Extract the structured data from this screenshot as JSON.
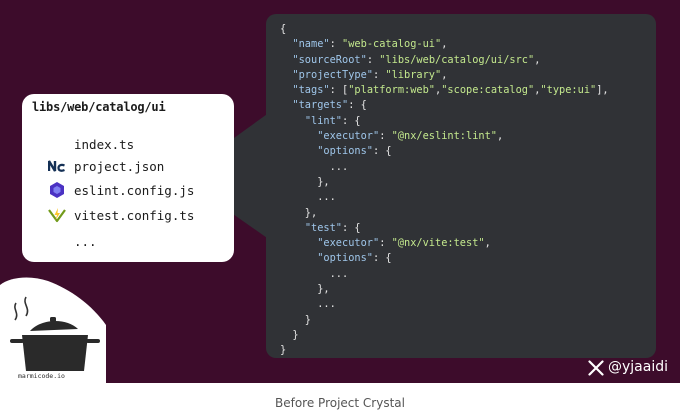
{
  "card": {
    "title": "libs/web/catalog/ui",
    "files": [
      {
        "name": "index.ts",
        "icon": "none"
      },
      {
        "name": "project.json",
        "icon": "nx-icon"
      },
      {
        "name": "eslint.config.js",
        "icon": "eslint-icon"
      },
      {
        "name": "vitest.config.ts",
        "icon": "vitest-icon"
      },
      {
        "name": "...",
        "icon": "none"
      }
    ]
  },
  "code_lines": [
    [
      [
        "p",
        "{"
      ]
    ],
    [
      [
        "p",
        "  "
      ],
      [
        "k",
        "\"name\""
      ],
      [
        "p",
        ": "
      ],
      [
        "s",
        "\"web-catalog-ui\""
      ],
      [
        "p",
        ","
      ]
    ],
    [
      [
        "p",
        "  "
      ],
      [
        "k",
        "\"sourceRoot\""
      ],
      [
        "p",
        ": "
      ],
      [
        "s",
        "\"libs/web/catalog/ui/src\""
      ],
      [
        "p",
        ","
      ]
    ],
    [
      [
        "p",
        "  "
      ],
      [
        "k",
        "\"projectType\""
      ],
      [
        "p",
        ": "
      ],
      [
        "s",
        "\"library\""
      ],
      [
        "p",
        ","
      ]
    ],
    [
      [
        "p",
        "  "
      ],
      [
        "k",
        "\"tags\""
      ],
      [
        "p",
        ": ["
      ],
      [
        "s",
        "\"platform:web\""
      ],
      [
        "p",
        ","
      ],
      [
        "s",
        "\"scope:catalog\""
      ],
      [
        "p",
        ","
      ],
      [
        "s",
        "\"type:ui\""
      ],
      [
        "p",
        "],"
      ]
    ],
    [
      [
        "p",
        "  "
      ],
      [
        "k",
        "\"targets\""
      ],
      [
        "p",
        ": {"
      ]
    ],
    [
      [
        "p",
        "    "
      ],
      [
        "k",
        "\"lint\""
      ],
      [
        "p",
        ": {"
      ]
    ],
    [
      [
        "p",
        "      "
      ],
      [
        "k",
        "\"executor\""
      ],
      [
        "p",
        ": "
      ],
      [
        "s",
        "\"@nx/eslint:lint\""
      ],
      [
        "p",
        ","
      ]
    ],
    [
      [
        "p",
        "      "
      ],
      [
        "k",
        "\"options\""
      ],
      [
        "p",
        ": {"
      ]
    ],
    [
      [
        "p",
        "        ..."
      ]
    ],
    [
      [
        "p",
        "      },"
      ]
    ],
    [
      [
        "p",
        "      ..."
      ]
    ],
    [
      [
        "p",
        "    },"
      ]
    ],
    [
      [
        "p",
        "    "
      ],
      [
        "k",
        "\"test\""
      ],
      [
        "p",
        ": {"
      ]
    ],
    [
      [
        "p",
        "      "
      ],
      [
        "k",
        "\"executor\""
      ],
      [
        "p",
        ": "
      ],
      [
        "s",
        "\"@nx/vite:test\""
      ],
      [
        "p",
        ","
      ]
    ],
    [
      [
        "p",
        "      "
      ],
      [
        "k",
        "\"options\""
      ],
      [
        "p",
        ": {"
      ]
    ],
    [
      [
        "p",
        "        ..."
      ]
    ],
    [
      [
        "p",
        "      },"
      ]
    ],
    [
      [
        "p",
        "      ..."
      ]
    ],
    [
      [
        "p",
        "    }"
      ]
    ],
    [
      [
        "p",
        "  }"
      ]
    ],
    [
      [
        "p",
        "}"
      ]
    ]
  ],
  "mascot": {
    "label": "marmicode.io"
  },
  "watermark": {
    "handle": "@yjaaidi",
    "icon": "x-logo-icon"
  },
  "caption": "Before Project Crystal",
  "colors": {
    "background": "#3d0c2b",
    "panel": "#303236",
    "key": "#9fc6ea",
    "string": "#c3e88d",
    "card": "#ffffff"
  }
}
